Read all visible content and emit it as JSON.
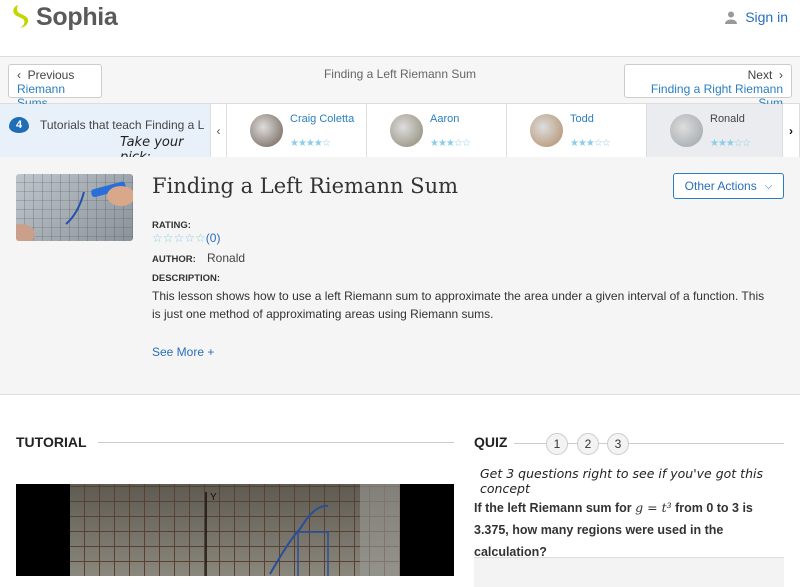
{
  "header": {
    "logo": "Sophia",
    "signin": "Sign in",
    "brand_color": "#c4d600"
  },
  "nav": {
    "prev_label": "Previous",
    "prev_title": "Riemann Sums",
    "current": "Finding a Left Riemann Sum",
    "next_label": "Next",
    "next_title": "Finding a Right Riemann Sum"
  },
  "tutorials": {
    "count": "4",
    "text": "Tutorials that teach Finding a Left Riemann Sum",
    "pick": "Take your pick:",
    "cards": [
      {
        "name": "Craig Coletta",
        "rating": 4
      },
      {
        "name": "Aaron",
        "rating": 3
      },
      {
        "name": "Todd",
        "rating": 3
      },
      {
        "name": "Ronald",
        "rating": 3,
        "selected": true
      }
    ]
  },
  "lesson": {
    "title": "Finding a Left Riemann Sum",
    "other_actions": "Other Actions",
    "rating_label": "RATING:",
    "rating_count": "(0)",
    "author_label": "AUTHOR:",
    "author": "Ronald",
    "description_label": "DESCRIPTION:",
    "description": "This lesson shows how to use a left Riemann sum to approximate the area under a given interval of a function. This is just one method of approximating areas using Riemann sums.",
    "see_more": "See More +"
  },
  "tutorial": {
    "heading": "TUTORIAL"
  },
  "quiz": {
    "heading": "QUIZ",
    "numbers": [
      "1",
      "2",
      "3"
    ],
    "subtitle": "Get 3 questions right to see if you've got this concept",
    "question_pre": "If the left Riemann sum for ",
    "question_math": "g = t³",
    "question_post": " from 0 to 3 is 3.375, how many regions were used in the calculation?"
  }
}
